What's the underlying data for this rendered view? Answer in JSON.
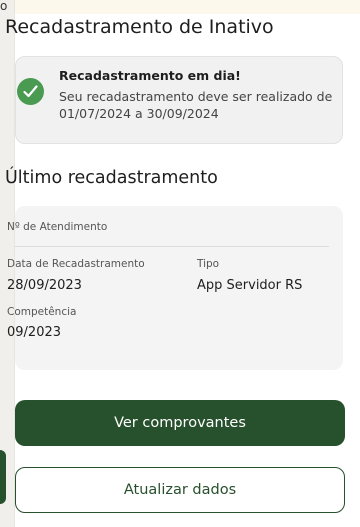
{
  "background_page": {
    "top_text": "o"
  },
  "modal": {
    "title": "Recadastramento de Inativo",
    "status": {
      "icon": "check-circle-icon",
      "title": "Recadastramento em dia!",
      "message": "Seu recadastramento deve ser realizado de 01/07/2024 a 30/09/2024"
    },
    "last_section": {
      "heading": "Último recadastramento",
      "atendimento_label": "Nº de Atendimento",
      "data_label": "Data de Recadastramento",
      "data_value": "28/09/2023",
      "tipo_label": "Tipo",
      "tipo_value": "App Servidor RS",
      "competencia_label": "Competência",
      "competencia_value": "09/2023"
    },
    "actions": {
      "view_receipts": "Ver comprovantes",
      "update_data": "Atualizar dados"
    }
  },
  "colors": {
    "primary": "#27502d",
    "success": "#4b9a52"
  }
}
